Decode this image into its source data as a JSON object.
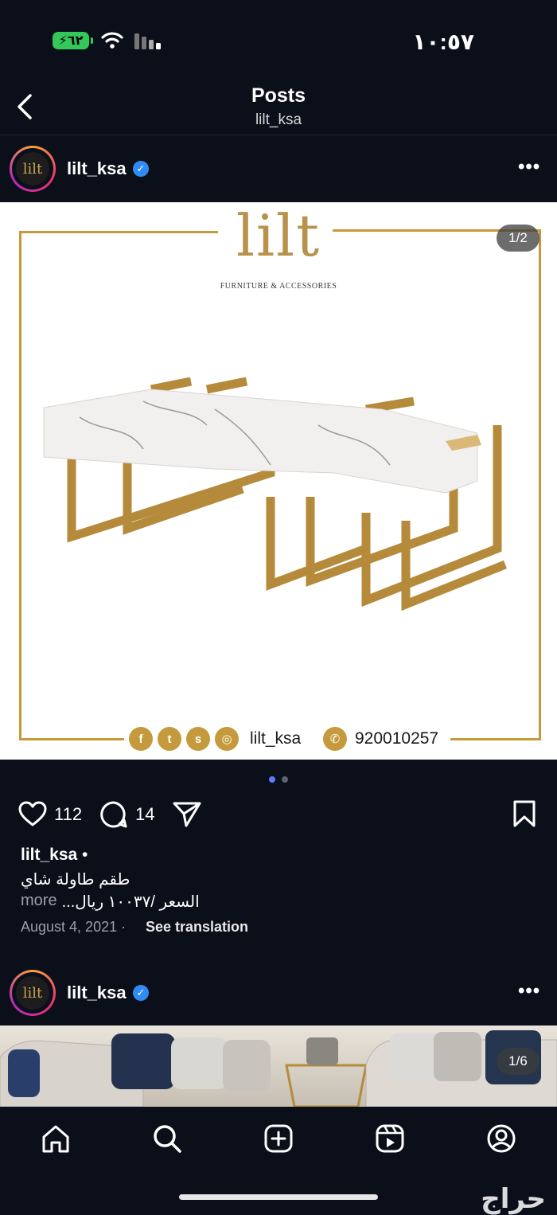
{
  "status_bar": {
    "time": "١٠:٥٧",
    "battery": "٦٢"
  },
  "header": {
    "title": "Posts",
    "subtitle": "lilt_ksa"
  },
  "post1": {
    "username": "lilt_ksa",
    "brand_logo": "lilt",
    "brand_sub": "FURNITURE & ACCESSORIES",
    "image_counter": "1/2",
    "social_handle": "lilt_ksa",
    "phone": "920010257",
    "likes": "112",
    "comments": "14",
    "caption_user": "lilt_ksa",
    "caption_line1": "طقم طاولة شاي",
    "caption_line2": "السعر /١٠٠٣٧ ريال...",
    "caption_more": "more",
    "date": "August 4, 2021",
    "see_translation": "See translation",
    "carousel_position": 1,
    "carousel_total": 2
  },
  "post2": {
    "username": "lilt_ksa",
    "image_counter": "1/6"
  },
  "watermark": "حراج",
  "colors": {
    "background": "#0b0f1a",
    "accent_gold": "#c49a3c",
    "verified": "#2f8cf5",
    "active_dot": "#5a7dff"
  },
  "nav": {
    "items": [
      "home-icon",
      "search-icon",
      "create-icon",
      "reels-icon",
      "profile-icon"
    ]
  }
}
